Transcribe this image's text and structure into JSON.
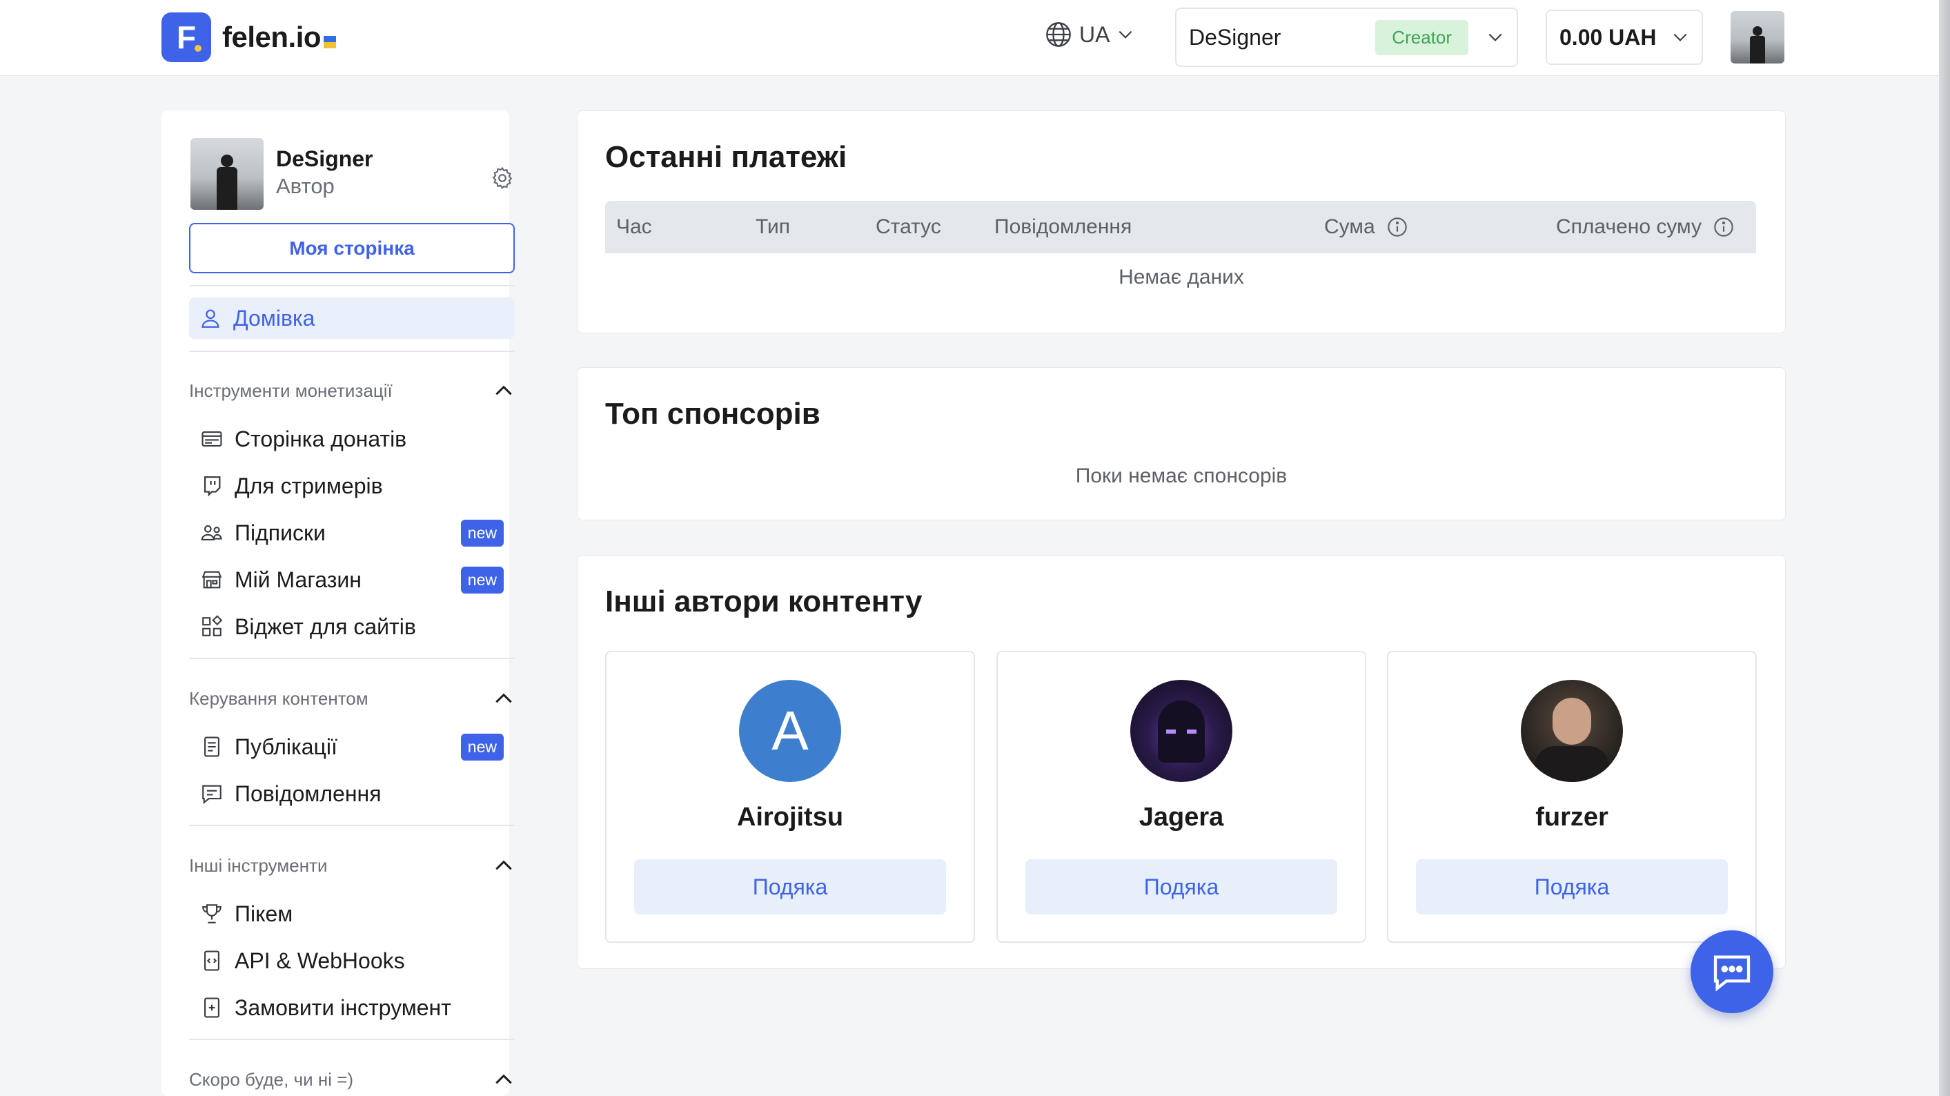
{
  "header": {
    "logo_letter": "F",
    "logo_text": "felen.io",
    "language": "UA",
    "account_name": "DeSigner",
    "account_badge": "Creator",
    "balance": "0.00 UAH"
  },
  "sidebar": {
    "profile_name": "DeSigner",
    "profile_role": "Автор",
    "my_page_button": "Моя сторінка",
    "home": "Домівка",
    "sections": [
      {
        "title": "Інструменти монетизації",
        "items": [
          {
            "label": "Сторінка донатів",
            "icon": "donation-page-icon",
            "badge": ""
          },
          {
            "label": "Для стримерів",
            "icon": "twitch-icon",
            "badge": ""
          },
          {
            "label": "Підписки",
            "icon": "subscribers-icon",
            "badge": "new"
          },
          {
            "label": "Мій Магазин",
            "icon": "store-icon",
            "badge": "new"
          },
          {
            "label": "Віджет для сайтів",
            "icon": "widget-icon",
            "badge": ""
          }
        ]
      },
      {
        "title": "Керування контентом",
        "items": [
          {
            "label": "Публікації",
            "icon": "document-icon",
            "badge": "new"
          },
          {
            "label": "Повідомлення",
            "icon": "message-icon",
            "badge": ""
          }
        ]
      },
      {
        "title": "Інші інструменти",
        "items": [
          {
            "label": "Пікем",
            "icon": "trophy-icon",
            "badge": ""
          },
          {
            "label": "API & WebHooks",
            "icon": "code-file-icon",
            "badge": ""
          },
          {
            "label": "Замовити інструмент",
            "icon": "add-file-icon",
            "badge": ""
          }
        ]
      },
      {
        "title": "Скоро буде, чи ні =)",
        "items": []
      }
    ]
  },
  "payments": {
    "title": "Останні платежі",
    "columns": [
      "Час",
      "Тип",
      "Статус",
      "Повідомлення",
      "Сума",
      "Сплачено суму"
    ],
    "empty": "Немає даних"
  },
  "sponsors": {
    "title": "Топ спонсорів",
    "empty": "Поки немає спонсорів"
  },
  "authors": {
    "title": "Інші автори контенту",
    "thanks_label": "Подяка",
    "list": [
      {
        "name": "Airojitsu",
        "initial": "A",
        "color": "#3d7fce"
      },
      {
        "name": "Jagera",
        "initial": "",
        "color": "#1a1430"
      },
      {
        "name": "furzer",
        "initial": "",
        "color": "#2b2622"
      }
    ]
  }
}
